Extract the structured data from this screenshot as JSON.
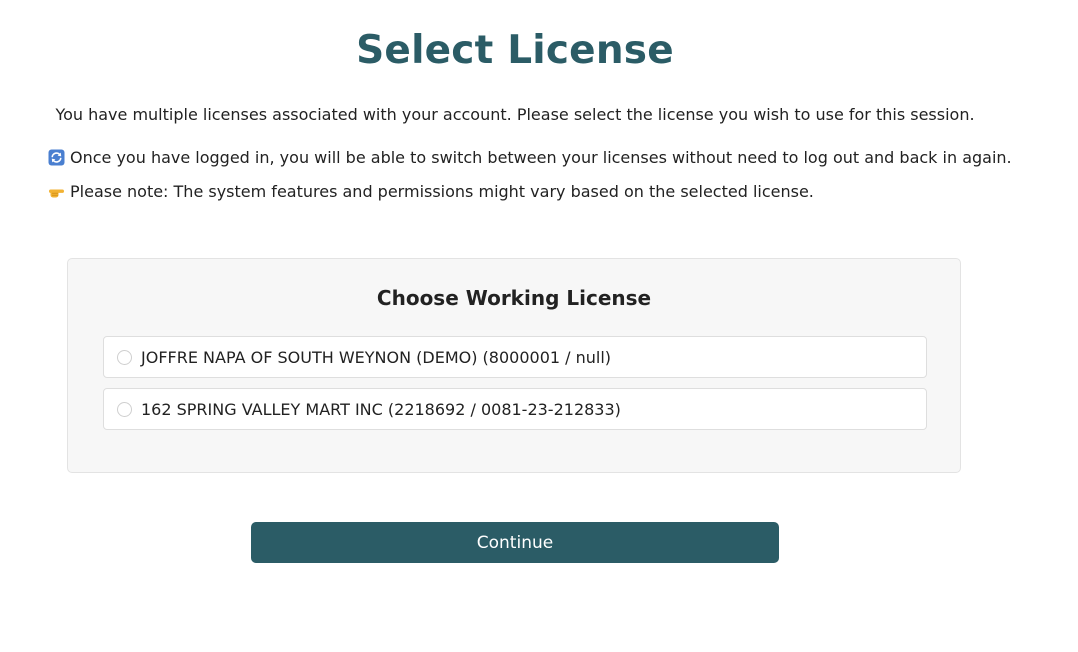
{
  "page": {
    "title": "Select License",
    "intro": "You have multiple licenses associated with your account. Please select the license you wish to use for this session."
  },
  "notes": [
    {
      "icon": "refresh-icon",
      "text": "Once you have logged in, you will be able to switch between your licenses without need to log out and back in again."
    },
    {
      "icon": "pointing-hand-icon",
      "text": "Please note: The system features and permissions might vary based on the selected license."
    }
  ],
  "license_card": {
    "title": "Choose Working License",
    "options": [
      {
        "label": "JOFFRE NAPA OF SOUTH WEYNON (DEMO) (8000001 / null)",
        "selected": false
      },
      {
        "label": "162 SPRING VALLEY MART INC (2218692 / 0081-23-212833)",
        "selected": false
      }
    ]
  },
  "actions": {
    "continue_label": "Continue"
  },
  "colors": {
    "accent": "#2b5c66",
    "card_background": "#f7f7f7",
    "refresh_icon": "#4a7fd0",
    "hand_icon": "#f2b233"
  }
}
